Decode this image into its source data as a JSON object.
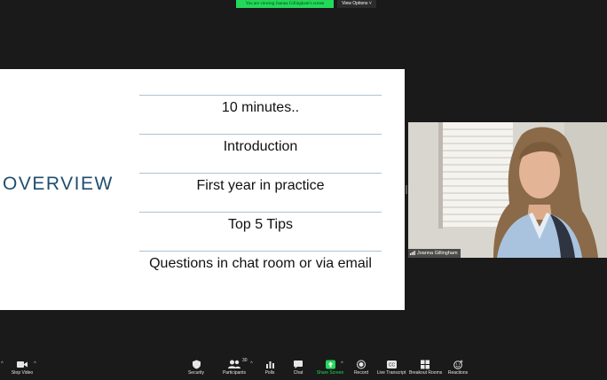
{
  "top": {
    "viewing_banner": "You are viewing Joanna Gillingham's screen",
    "view_options": "View Options ˅"
  },
  "slide": {
    "title": "OVERVIEW",
    "bullets": [
      "10 minutes..",
      "Introduction",
      "First year in practice",
      "Top 5 Tips",
      "Questions in chat room or via email"
    ]
  },
  "video": {
    "name": "Joanna Gillingham"
  },
  "toolbar": {
    "stop_video": "Stop Video",
    "security": "Security",
    "participants": "Participants",
    "participants_count": "30",
    "polls": "Polls",
    "chat": "Chat",
    "share_screen": "Share Screen",
    "record": "Record",
    "live_transcript": "Live Transcript",
    "breakout_rooms": "Breakout Rooms",
    "reactions": "Reactions"
  },
  "colors": {
    "banner": "#23d959",
    "slide_title": "#1f4e6e",
    "share_screen": "#23d959"
  }
}
